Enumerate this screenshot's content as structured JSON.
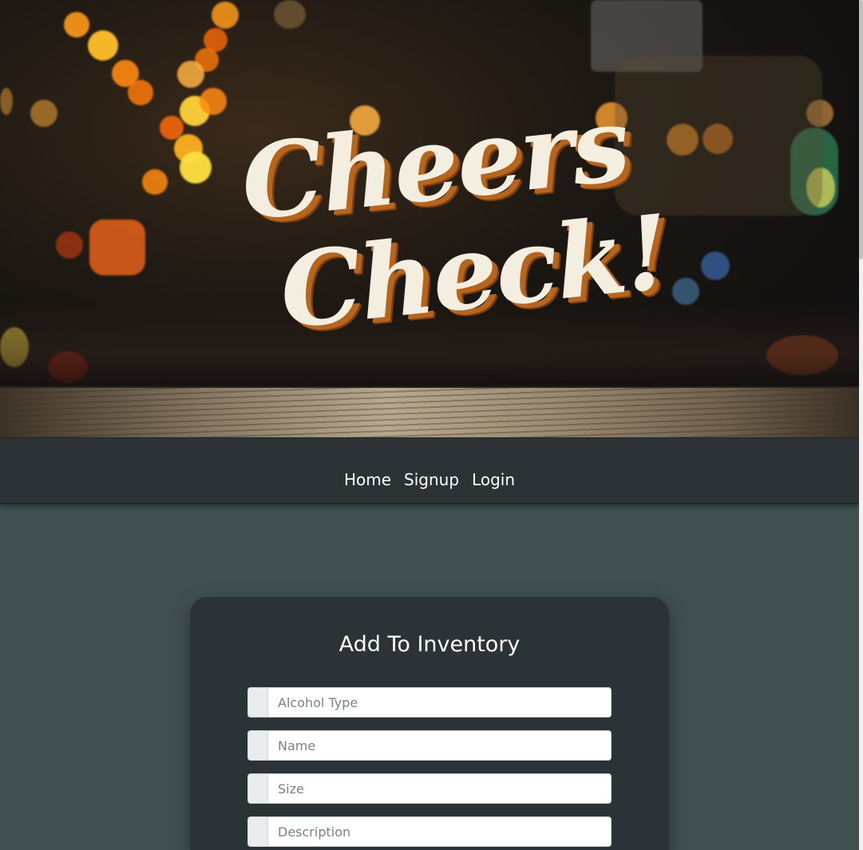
{
  "hero": {
    "logo_line1": "Cheers",
    "logo_line2": "Check!"
  },
  "nav": {
    "items": [
      {
        "label": "Home"
      },
      {
        "label": "Signup"
      },
      {
        "label": "Login"
      }
    ]
  },
  "form": {
    "title": "Add To Inventory",
    "fields": [
      {
        "placeholder": "Alcohol Type",
        "value": ""
      },
      {
        "placeholder": "Name",
        "value": ""
      },
      {
        "placeholder": "Size",
        "value": ""
      },
      {
        "placeholder": "Description",
        "value": ""
      }
    ]
  },
  "colors": {
    "page_background": "#405050",
    "nav_background": "#2c3336",
    "card_background": "#2c3336",
    "logo_text": "#f3eee0",
    "logo_shadow": "#b5651d"
  }
}
